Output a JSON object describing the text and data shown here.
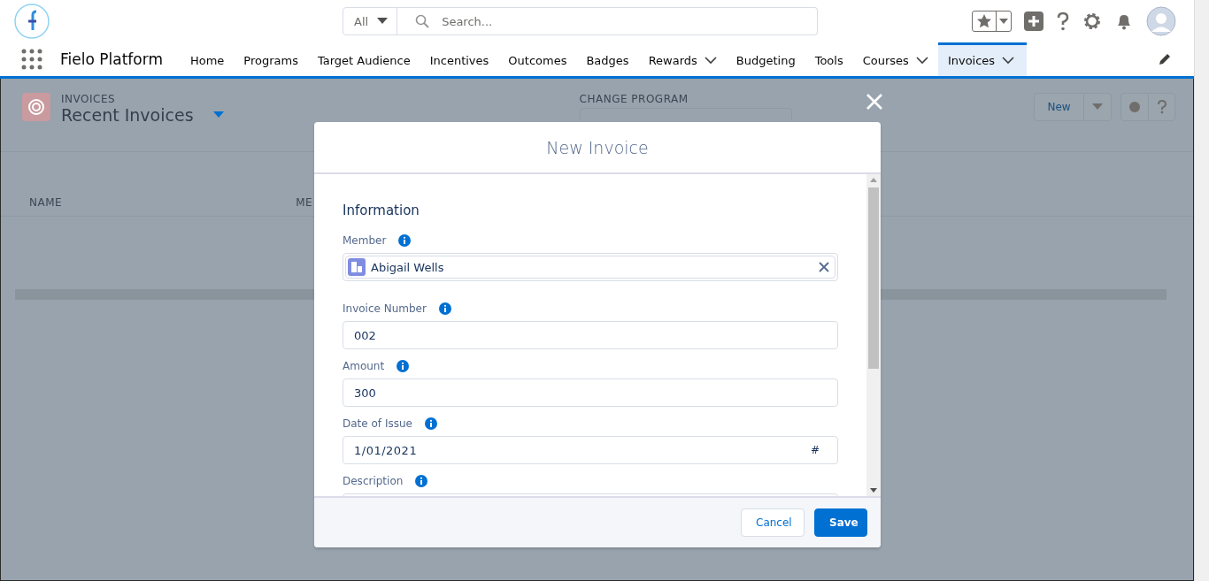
{
  "app": {
    "name": "Fielo Platform"
  },
  "search": {
    "scope": "All",
    "placeholder": "Search..."
  },
  "nav": [
    {
      "label": "Home",
      "has_menu": false,
      "selected": false
    },
    {
      "label": "Programs",
      "has_menu": false,
      "selected": false
    },
    {
      "label": "Target Audience",
      "has_menu": false,
      "selected": false
    },
    {
      "label": "Incentives",
      "has_menu": false,
      "selected": false
    },
    {
      "label": "Outcomes",
      "has_menu": false,
      "selected": false
    },
    {
      "label": "Badges",
      "has_menu": false,
      "selected": false
    },
    {
      "label": "Rewards",
      "has_menu": true,
      "selected": false
    },
    {
      "label": "Budgeting",
      "has_menu": false,
      "selected": false
    },
    {
      "label": "Tools",
      "has_menu": false,
      "selected": false
    },
    {
      "label": "Courses",
      "has_menu": true,
      "selected": false
    },
    {
      "label": "Invoices",
      "has_menu": true,
      "selected": true
    }
  ],
  "list_view": {
    "object": "INVOICES",
    "title": "Recent Invoices",
    "program_label": "CHANGE PROGRAM",
    "new_button": "New",
    "columns": [
      "NAME",
      "ME"
    ]
  },
  "modal": {
    "title": "New Invoice",
    "section": "Information",
    "fields": [
      {
        "label": "Member",
        "kind": "lookup",
        "value": "Abigail Wells"
      },
      {
        "label": "Invoice Number",
        "kind": "text",
        "value": "002"
      },
      {
        "label": "Amount",
        "kind": "text",
        "value": "300"
      },
      {
        "label": "Date of Issue",
        "kind": "date",
        "value": "1/01/2021",
        "icon_text": "#"
      },
      {
        "label": "Description",
        "kind": "textarea"
      }
    ],
    "buttons": [
      {
        "label": "Cancel",
        "kind": "neutral"
      },
      {
        "label": "Save",
        "kind": "brand"
      }
    ]
  }
}
